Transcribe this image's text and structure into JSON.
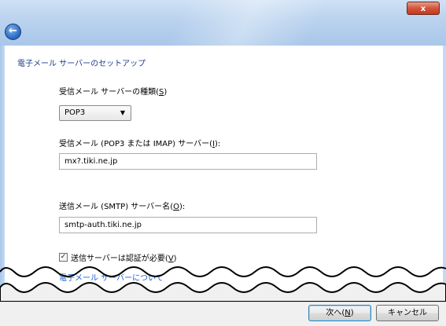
{
  "window": {
    "close_glyph": "x",
    "back_glyph": "←"
  },
  "main": {
    "title": "電子メール サーバーのセットアップ",
    "incoming_type_label": "受信メール サーバーの種類",
    "incoming_type_key": "S",
    "incoming_type_value": "POP3",
    "incoming_server_label": "受信メール (POP3 または IMAP) サーバー",
    "incoming_server_key": "I",
    "incoming_server_value": "mx?.tiki.ne.jp",
    "outgoing_server_label": "送信メール (SMTP) サーバー名",
    "outgoing_server_key": "O",
    "outgoing_server_value": "smtp-auth.tiki.ne.jp",
    "auth_required_label": "送信サーバーは認証が必要",
    "auth_required_key": "V",
    "auth_required_checked": true,
    "partial_link_text": "電子メール サーバーについて"
  },
  "footer": {
    "next_label": "次へ",
    "next_key": "N",
    "cancel_label": "キャンセル"
  },
  "colors": {
    "title_blue": "#1c3b8c",
    "link_blue": "#1c5fcf",
    "close_red": "#c03a20"
  }
}
